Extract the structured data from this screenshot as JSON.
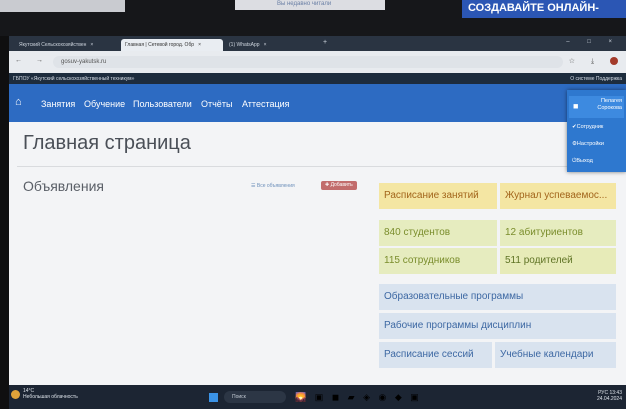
{
  "top_strip": {
    "glare_text": "Вы недавно читали",
    "banner_text": "СОЗДАВАЙТЕ ОНЛАЙН-"
  },
  "browser": {
    "tabs": [
      {
        "label": "Якутский Сельскохозяйствен",
        "close": "×"
      },
      {
        "label": "Главная | Сетевой город. Обр",
        "close": "×"
      },
      {
        "label": "(1) WhatsApp",
        "close": "×"
      }
    ],
    "new_tab": "+",
    "window_controls": "– □ ×",
    "nav_controls": "← → C",
    "url": "gosuv-yakutsk.ru",
    "right_icons": "☆ ⤓"
  },
  "site_bar": {
    "left": "ГБПОУ «Якутский сельскохозяйственный техникум»",
    "right": "О системе   Поддержка"
  },
  "navbar": {
    "home_icon": "home-icon",
    "items": [
      "Занятия",
      "Обучение",
      "Пользователи",
      "Отчёты",
      "Аттестация"
    ]
  },
  "user_menu": {
    "name": "Пелагея Сорокова",
    "items": [
      "✔Сотрудник",
      "⚙Настройки",
      "⏻Выход"
    ]
  },
  "page": {
    "title": "Главная страница",
    "announcements_heading": "Объявления",
    "all_announcements": "☰ Все объявления",
    "add_button": "✚ Добавить"
  },
  "tiles": {
    "schedule": "Расписание занятий",
    "gradebook": "Журнал успеваемос...",
    "students": "840 студентов",
    "applicants": "12 абитуриентов",
    "staff": "115 сотрудников",
    "parents": "511 родителей",
    "programs": "Образовательные программы",
    "work_programs": "Рабочие программы дисциплин",
    "sessions": "Расписание сессий",
    "calendars": "Учебные календари"
  },
  "taskbar": {
    "temperature": "14°C",
    "weather": "Небольшая облачность",
    "search_label": "Поиск",
    "apps": "🌄 ▣ ◼ ▰ ◈ ◉ ◆ ▣",
    "lang": "РУС",
    "time": "13:43",
    "date": "24.04.2024"
  }
}
